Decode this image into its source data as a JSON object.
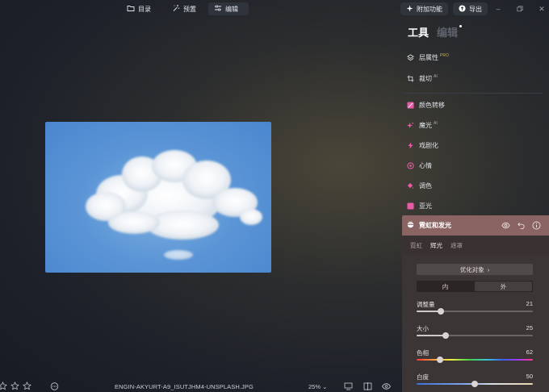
{
  "topbar": {
    "nav": [
      {
        "label": "目录",
        "icon": "folder-icon",
        "active": false
      },
      {
        "label": "预置",
        "icon": "magic-wand-icon",
        "active": false
      },
      {
        "label": "编辑",
        "icon": "sliders-icon",
        "active": true
      }
    ],
    "addons_label": "附加功能",
    "export_label": "导出"
  },
  "panel": {
    "tab_tools": "工具",
    "tab_edit": "编辑",
    "tools_top": [
      {
        "label": "层属性",
        "badge": "PRO",
        "icon": "layers-icon"
      },
      {
        "label": "裁切",
        "sup": "AI",
        "icon": "crop-icon"
      }
    ],
    "tools": [
      {
        "label": "颜色转移",
        "icon": "color-transfer-icon"
      },
      {
        "label": "魔光",
        "sup": "AI",
        "icon": "sparkle-icon"
      },
      {
        "label": "戏剧化",
        "icon": "lightning-icon"
      },
      {
        "label": "心情",
        "icon": "mood-icon"
      },
      {
        "label": "调色",
        "icon": "paint-bucket-icon"
      },
      {
        "label": "亚光",
        "icon": "matte-icon"
      }
    ],
    "section": {
      "title": "霓虹和发光",
      "subtabs": [
        "霓虹",
        "辉光",
        "遮罩"
      ],
      "active_subtab": 1,
      "optimize_label": "优化对象",
      "segments": [
        "内",
        "外"
      ],
      "active_segment": 1,
      "sliders": [
        {
          "label": "调整量",
          "value": "21",
          "fraction": 0.21
        },
        {
          "label": "大小",
          "value": "25",
          "fraction": 0.25
        },
        {
          "label": "色相",
          "value": "62",
          "fraction": 0.2
        },
        {
          "label": "白度",
          "value": "50",
          "fraction": 0.5
        }
      ]
    }
  },
  "bottombar": {
    "filename": "ENGIN-AKYURT-A9_ISUTJHM4-UNSPLASH.JPG",
    "zoom": "25%"
  },
  "colors": {
    "accent_section": "#8a6462",
    "pink_icons": "#e85aa8",
    "pro_badge": "#c7b34a"
  }
}
